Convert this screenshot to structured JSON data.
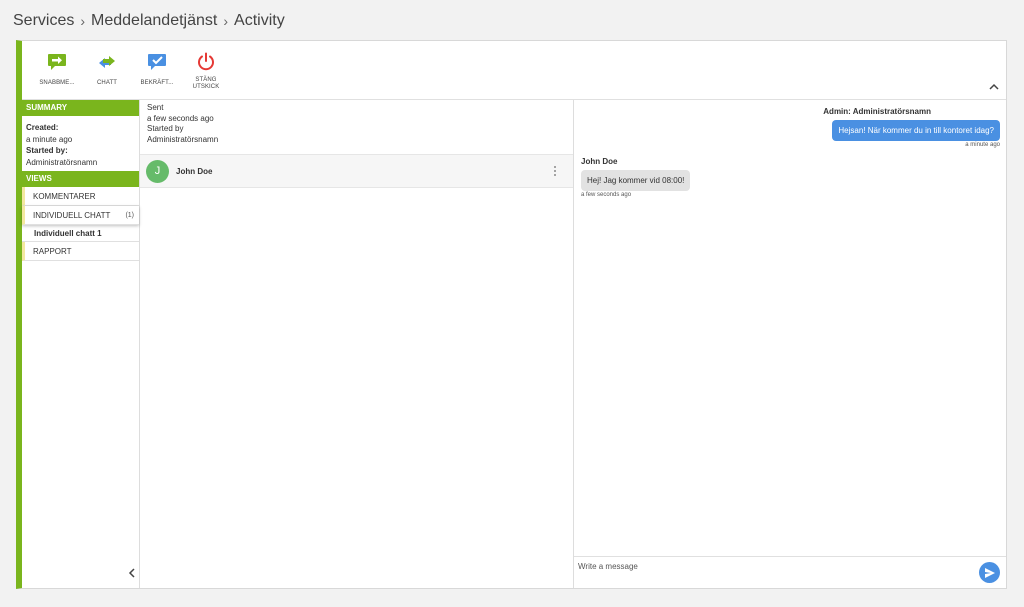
{
  "breadcrumb": {
    "items": [
      "Services",
      "Meddelandetjänst",
      "Activity"
    ]
  },
  "toolbar": {
    "quick": "SNABBME...",
    "chat": "CHATT",
    "confirm": "BEKRÄFT...",
    "close_line1": "STÄNG",
    "close_line2": "UTSKICK"
  },
  "summary": {
    "heading": "SUMMARY",
    "created_label": "Created:",
    "created_value": "a minute ago",
    "started_label": "Started by:",
    "started_value": "Administratörsnamn"
  },
  "views": {
    "heading": "VIEWS",
    "items": [
      {
        "label": "KOMMENTARER",
        "count": ""
      },
      {
        "label": "INDIVIDUELL CHATT",
        "count": "(1)"
      },
      {
        "label": "RAPPORT",
        "count": ""
      }
    ],
    "sub_item": "Individuell chatt 1"
  },
  "sent": {
    "sent_label": "Sent",
    "sent_value": "a few seconds ago",
    "started_label": "Started by",
    "started_value": "Administratörsnamn"
  },
  "recipient": {
    "initial": "J",
    "name": "John Doe"
  },
  "chat": {
    "outgoing": {
      "sender": "Admin: Administratörsnamn",
      "text": "Hejsan! När kommer du in till kontoret idag?",
      "time": "a minute ago"
    },
    "incoming": {
      "sender": "John Doe",
      "text": "Hej! Jag kommer vid 08:00!",
      "time": "a few seconds ago"
    },
    "placeholder": "Write a message"
  },
  "colors": {
    "accent": "#7ab51d",
    "primary": "#4a90e2",
    "danger": "#e53935"
  }
}
